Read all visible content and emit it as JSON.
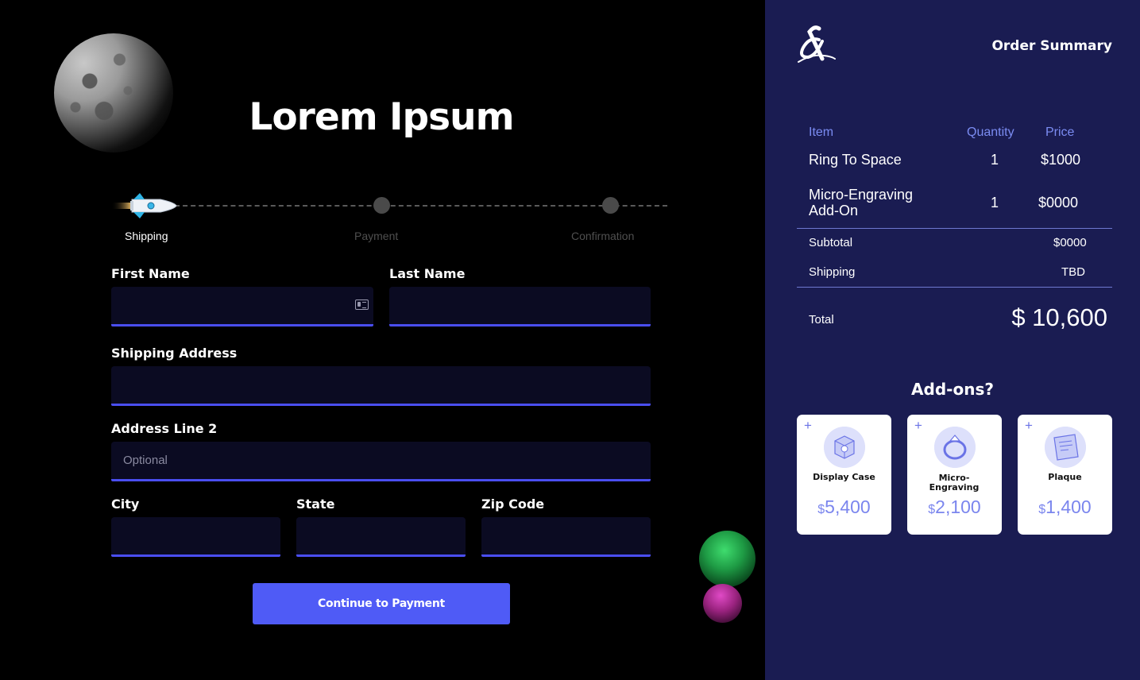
{
  "hero": {
    "title": "Lorem Ipsum"
  },
  "steps": [
    {
      "label": "Shipping",
      "active": true
    },
    {
      "label": "Payment",
      "active": false
    },
    {
      "label": "Confirmation",
      "active": false
    }
  ],
  "form": {
    "first_name_label": "First Name",
    "last_name_label": "Last Name",
    "shipping_address_label": "Shipping Address",
    "address2_label": "Address Line 2",
    "address2_placeholder": "Optional",
    "city_label": "City",
    "state_label": "State",
    "zip_label": "Zip Code",
    "continue_label": "Continue to Payment"
  },
  "summary": {
    "title": "Order Summary",
    "columns": {
      "item": "Item",
      "quantity": "Quantity",
      "price": "Price"
    },
    "rows": [
      {
        "item": "Ring To Space",
        "quantity": "1",
        "price": "$1000"
      },
      {
        "item": "Micro-Engraving Add-On",
        "quantity": "1",
        "price": "$0000"
      }
    ],
    "subtotal_label": "Subtotal",
    "subtotal_value": "$0000",
    "shipping_label": "Shipping",
    "shipping_value": "TBD",
    "total_label": "Total",
    "total_value": "$ 10,600"
  },
  "addons": {
    "title": "Add-ons?",
    "items": [
      {
        "name": "Display Case",
        "currency": "$",
        "amount": "5,400"
      },
      {
        "name": "Micro-Engraving",
        "currency": "$",
        "amount": "2,100"
      },
      {
        "name": "Plaque",
        "currency": "$",
        "amount": "1,400"
      }
    ]
  },
  "colors": {
    "accent": "#4f5bf6",
    "panel": "#1a1c52",
    "field_bg": "#0b0b22",
    "header_blue": "#7b8cf2"
  }
}
